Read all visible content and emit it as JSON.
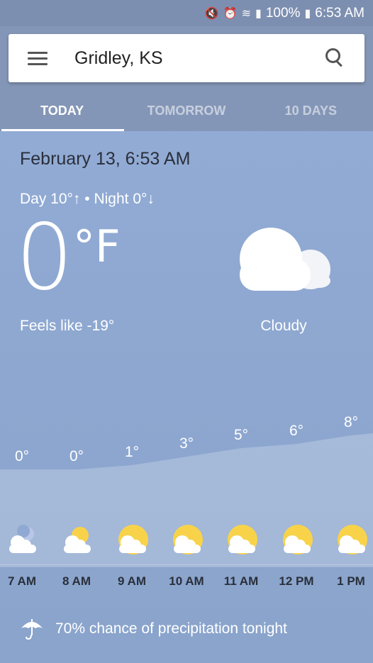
{
  "status_bar": {
    "battery": "100%",
    "time": "6:53 AM"
  },
  "header": {
    "location": "Gridley, KS"
  },
  "tabs": [
    {
      "label": "TODAY",
      "active": true
    },
    {
      "label": "TOMORROW",
      "active": false
    },
    {
      "label": "10 DAYS",
      "active": false
    }
  ],
  "current": {
    "date": "February 13, 6:53 AM",
    "day_night": "Day 10°↑ • Night 0°↓",
    "temp": "0",
    "unit": "°F",
    "feels_like": "Feels like -19°",
    "condition": "Cloudy",
    "condition_icon": "cloud-icon"
  },
  "chart_data": {
    "type": "area",
    "x": [
      "7 AM",
      "8 AM",
      "9 AM",
      "10 AM",
      "11 AM",
      "12 PM",
      "1 PM"
    ],
    "values": [
      0,
      0,
      1,
      3,
      5,
      6,
      8
    ],
    "value_labels": [
      "0°",
      "0°",
      "1°",
      "3°",
      "5°",
      "6°",
      "8°"
    ]
  },
  "hourly": [
    {
      "time": "7 AM",
      "icon": "partly-cloudy-night-icon"
    },
    {
      "time": "8 AM",
      "icon": "partly-cloudy-icon"
    },
    {
      "time": "9 AM",
      "icon": "partly-cloudy-icon"
    },
    {
      "time": "10 AM",
      "icon": "partly-cloudy-icon"
    },
    {
      "time": "11 AM",
      "icon": "partly-cloudy-icon"
    },
    {
      "time": "12 PM",
      "icon": "partly-cloudy-icon"
    },
    {
      "time": "1 PM",
      "icon": "partly-cloudy-icon"
    }
  ],
  "precipitation": {
    "text": "70% chance of precipitation tonight",
    "icon": "umbrella-icon"
  },
  "colors": {
    "sun": "#f8d34a",
    "moon": "#b8c6e8",
    "cloud": "#ffffff"
  }
}
